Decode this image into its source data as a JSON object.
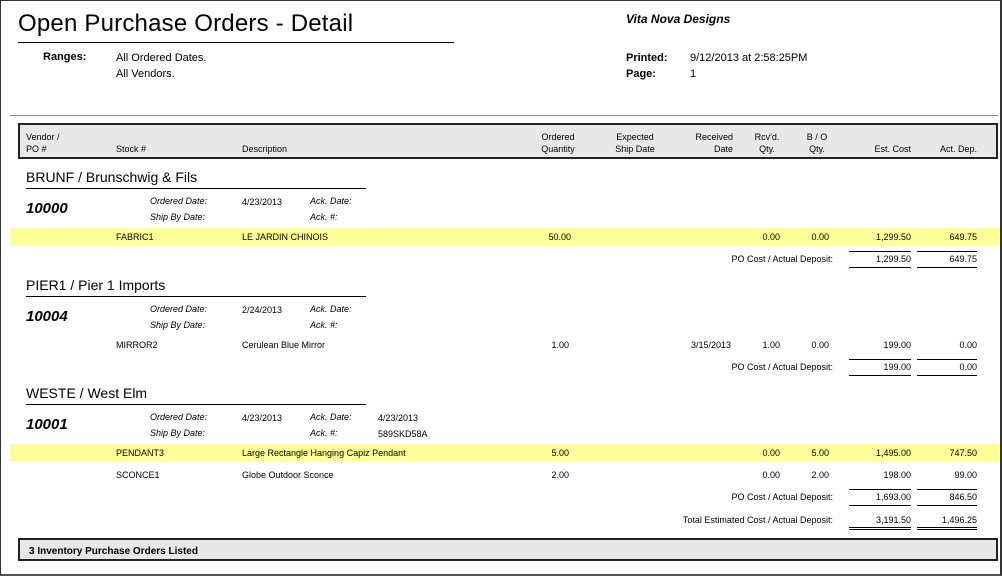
{
  "report": {
    "title": "Open Purchase Orders - Detail",
    "company": "Vita Nova Designs",
    "ranges_label": "Ranges:",
    "ranges": [
      "All Ordered Dates.",
      "All Vendors."
    ],
    "printed_label": "Printed:",
    "printed_value": "9/12/2013 at 2:58:25PM",
    "page_label": "Page:",
    "page_value": "1"
  },
  "columns": {
    "vendor_po": [
      "Vendor /",
      "PO #"
    ],
    "stock": "Stock #",
    "description": "Description",
    "ordered_qty": [
      "Ordered",
      "Quantity"
    ],
    "expected_ship": [
      "Expected",
      "Ship Date"
    ],
    "received": [
      "Received",
      "Date"
    ],
    "rcvd_qty": [
      "Rcv'd.",
      "Qty."
    ],
    "bo_qty": [
      "B / O",
      "Qty."
    ],
    "est_cost": "Est. Cost",
    "act_dep": "Act. Dep."
  },
  "labels": {
    "ordered_date": "Ordered  Date:",
    "ship_by_date": "Ship By Date:",
    "ack_date": "Ack. Date:",
    "ack_no": "Ack. #:",
    "po_cost": "PO Cost / Actual Deposit:",
    "total": "Total Estimated Cost / Actual Deposit:"
  },
  "groups": [
    {
      "vendor": "BRUNF / Brunschwig & Fils",
      "po": "10000",
      "ordered_date": "4/23/2013",
      "ack_date": "",
      "ack_no": "",
      "lines": [
        {
          "stock": "FABRIC1",
          "description": "LE JARDIN CHINOIS",
          "ordered_qty": "50.00",
          "expected_ship": "",
          "received": "",
          "rcvd_qty": "0.00",
          "bo_qty": "0.00",
          "est_cost": "1,299.50",
          "act_dep": "649.75",
          "highlight": true
        }
      ],
      "po_cost": "1,299.50",
      "po_dep": "649.75"
    },
    {
      "vendor": "PIER1 / Pier 1 Imports",
      "po": "10004",
      "ordered_date": "2/24/2013",
      "ack_date": "",
      "ack_no": "",
      "lines": [
        {
          "stock": "MIRROR2",
          "description": "Cerulean Blue Mirror",
          "ordered_qty": "1.00",
          "expected_ship": "",
          "received": "3/15/2013",
          "rcvd_qty": "1.00",
          "bo_qty": "0.00",
          "est_cost": "199.00",
          "act_dep": "0.00",
          "highlight": false
        }
      ],
      "po_cost": "199.00",
      "po_dep": "0.00"
    },
    {
      "vendor": "WESTE / West Elm",
      "po": "10001",
      "ordered_date": "4/23/2013",
      "ack_date": "4/23/2013",
      "ack_no": "589SKD58A",
      "lines": [
        {
          "stock": "PENDANT3",
          "description": "Large Rectangle Hanging Capiz Pendant",
          "ordered_qty": "5.00",
          "expected_ship": "",
          "received": "",
          "rcvd_qty": "0.00",
          "bo_qty": "5.00",
          "est_cost": "1,495.00",
          "act_dep": "747.50",
          "highlight": true
        },
        {
          "stock": "SCONCE1",
          "description": "Globe Outdoor Sconce",
          "ordered_qty": "2.00",
          "expected_ship": "",
          "received": "",
          "rcvd_qty": "0.00",
          "bo_qty": "2.00",
          "est_cost": "198.00",
          "act_dep": "99.00",
          "highlight": false
        }
      ],
      "po_cost": "1,693.00",
      "po_dep": "846.50"
    }
  ],
  "totals": {
    "est_cost": "3,191.50",
    "act_dep": "1,496.25"
  },
  "footer": "3 Inventory Purchase Orders Listed",
  "colors": {
    "highlight": "#ffff99",
    "header_bg": "#e8e8e8"
  }
}
